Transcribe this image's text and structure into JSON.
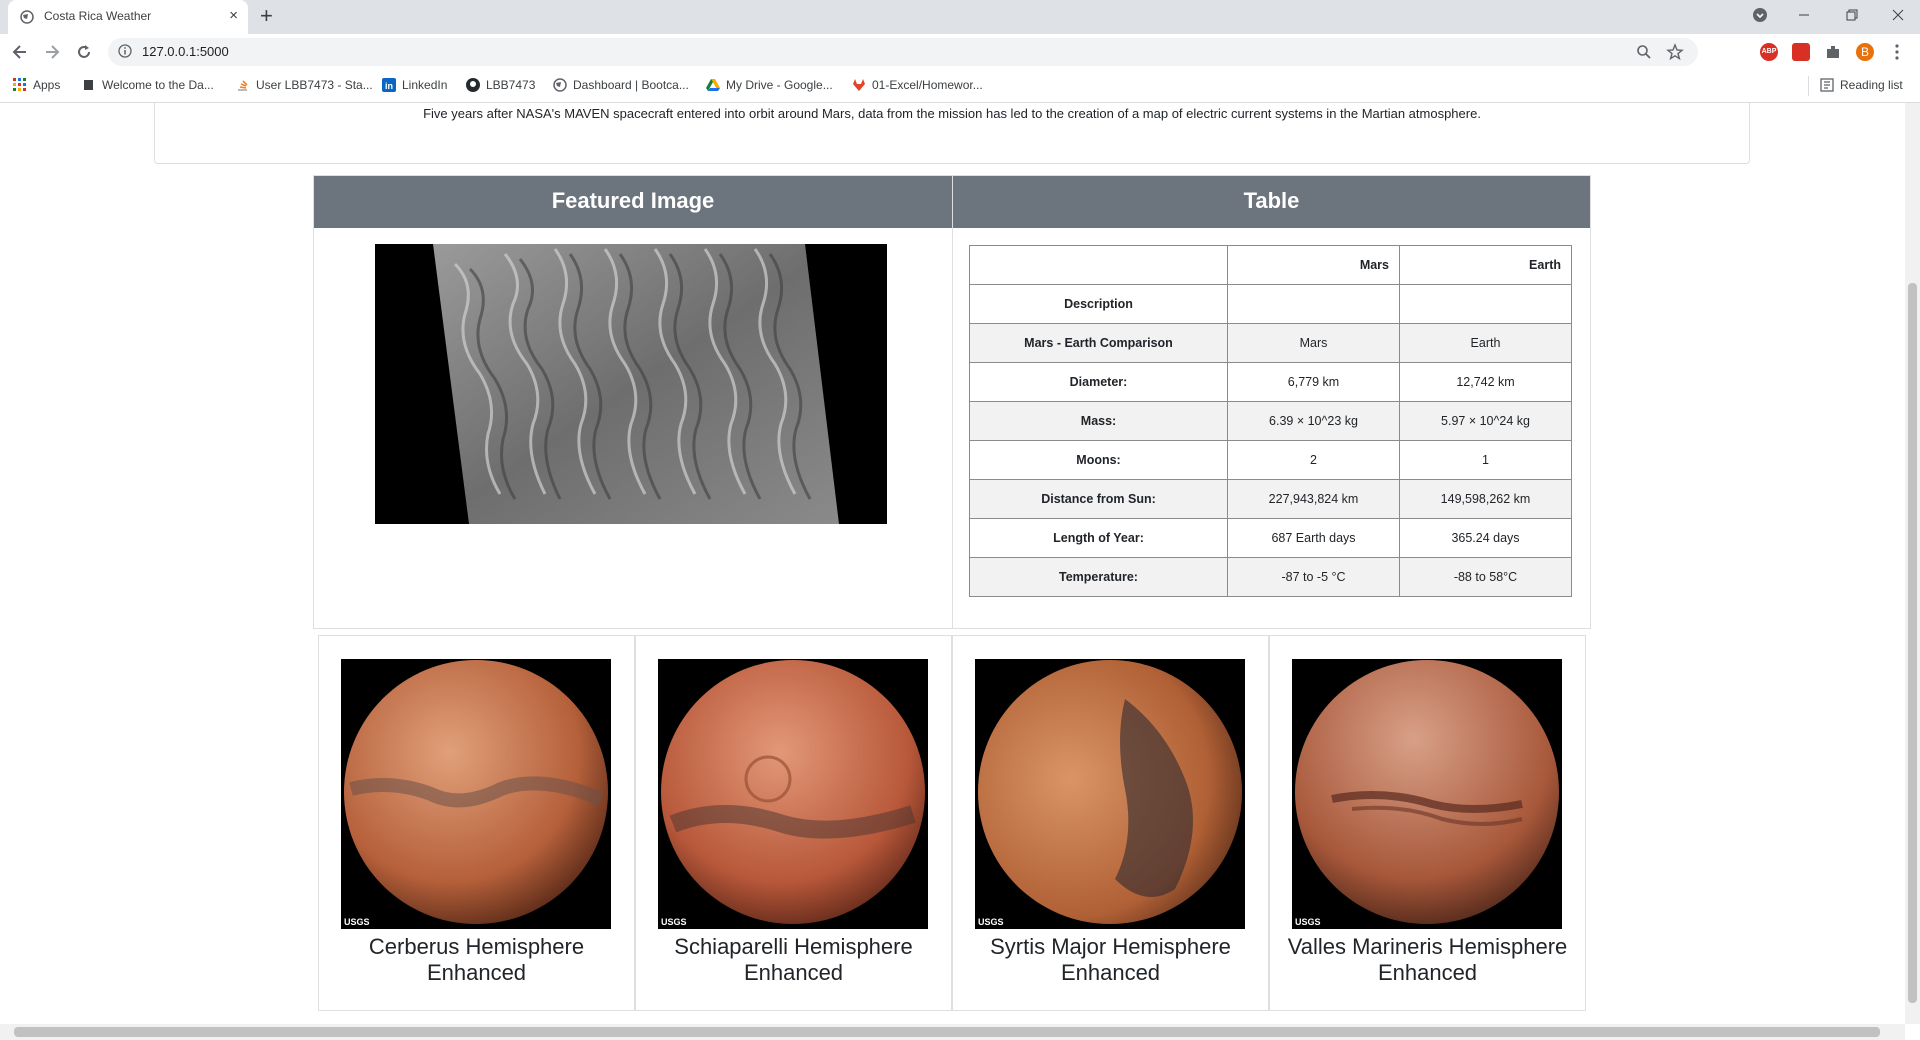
{
  "browser": {
    "tab_title": "Costa Rica Weather",
    "tab_close": "×",
    "new_tab": "+",
    "url": "127.0.0.1:5000",
    "profile_initial": "B",
    "bookmarks": [
      "Apps",
      "Welcome to the Da...",
      "User LBB7473 - Sta...",
      "LinkedIn",
      "LBB7473",
      "Dashboard | Bootca...",
      "My Drive - Google...",
      "01-Excel/Homewor..."
    ],
    "reading_list": "Reading list",
    "accent_profile": "#e8710a"
  },
  "news": {
    "paragraph": "Five years after NASA's MAVEN spacecraft entered into orbit around Mars, data from the mission has led to the creation of a map of electric current systems in the Martian atmosphere."
  },
  "featured": {
    "header": "Featured Image"
  },
  "table": {
    "header": "Table",
    "col_mars": "Mars",
    "col_earth": "Earth",
    "rows": [
      {
        "label": "Description",
        "mars": "",
        "earth": ""
      },
      {
        "label": "Mars - Earth Comparison",
        "mars": "Mars",
        "earth": "Earth"
      },
      {
        "label": "Diameter:",
        "mars": "6,779 km",
        "earth": "12,742 km"
      },
      {
        "label": "Mass:",
        "mars": "6.39 × 10^23 kg",
        "earth": "5.97 × 10^24 kg"
      },
      {
        "label": "Moons:",
        "mars": "2",
        "earth": "1"
      },
      {
        "label": "Distance from Sun:",
        "mars": "227,943,824 km",
        "earth": "149,598,262 km"
      },
      {
        "label": "Length of Year:",
        "mars": "687 Earth days",
        "earth": "365.24 days"
      },
      {
        "label": "Temperature:",
        "mars": "-87 to -5 °C",
        "earth": "-88 to 58°C"
      }
    ]
  },
  "hemispheres": [
    {
      "title": "Cerberus Hemisphere Enhanced"
    },
    {
      "title": "Schiaparelli Hemisphere Enhanced"
    },
    {
      "title": "Syrtis Major Hemisphere Enhanced"
    },
    {
      "title": "Valles Marineris Hemisphere Enhanced"
    }
  ],
  "usgs_mark": "USGS",
  "colors": {
    "panel_header": "#6c757d",
    "tab_strip": "#dee1e6"
  }
}
